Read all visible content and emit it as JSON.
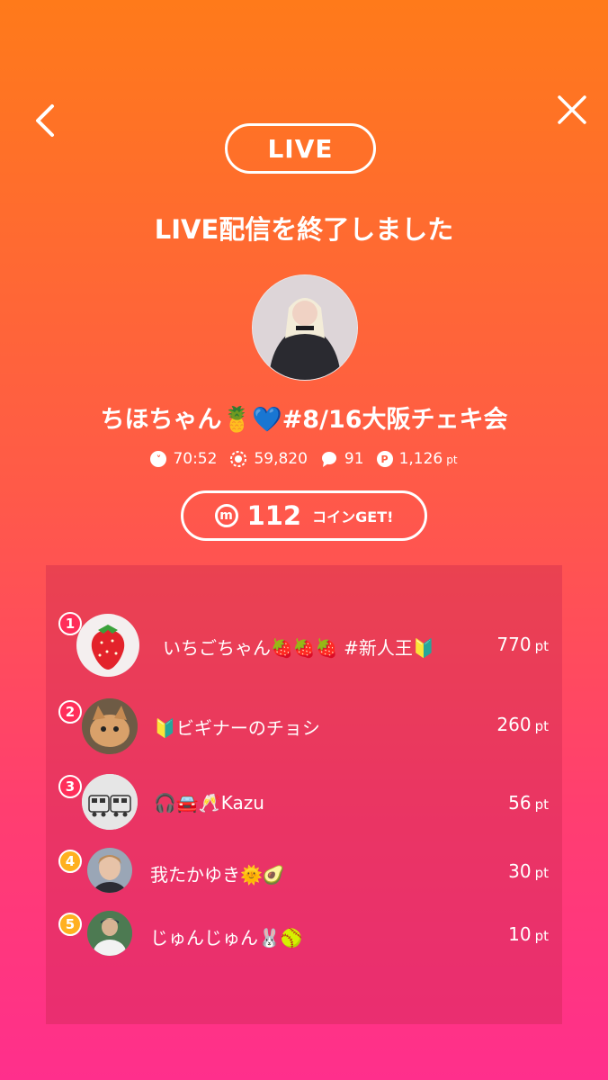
{
  "header": {
    "back_icon": "chevron-left-icon",
    "close_icon": "close-icon"
  },
  "live_badge": "LIVE",
  "ended_text": "LIVE配信を終了しました",
  "broadcast_title": "ちほちゃん🍍💙#8/16大阪チェキ会",
  "stats": {
    "duration": "70:52",
    "viewers": "59,820",
    "comments": "91",
    "points": "1,126",
    "points_unit": "pt"
  },
  "coins": {
    "amount": "112",
    "label": "コインGET!",
    "icon": "m-coin-icon"
  },
  "ranking": [
    {
      "rank": "1",
      "name": "いちごちゃん🍓🍓🍓 #新人王🔰",
      "points": "770",
      "unit": "pt"
    },
    {
      "rank": "2",
      "name": "🔰ビギナーのチョシ",
      "points": "260",
      "unit": "pt"
    },
    {
      "rank": "3",
      "name": "🎧🚘🥂Kazu",
      "points": "56",
      "unit": "pt"
    },
    {
      "rank": "4",
      "name": "我たかゆき🌞🥑",
      "points": "30",
      "unit": "pt"
    },
    {
      "rank": "5",
      "name": "じゅんじゅん🐰🥎",
      "points": "10",
      "unit": "pt"
    }
  ],
  "colors": {
    "gradient_top": "#ff7a1a",
    "gradient_bottom": "#ff2f8c",
    "rank_top3": "#ff2e5a",
    "rank_other": "#ffb020"
  }
}
